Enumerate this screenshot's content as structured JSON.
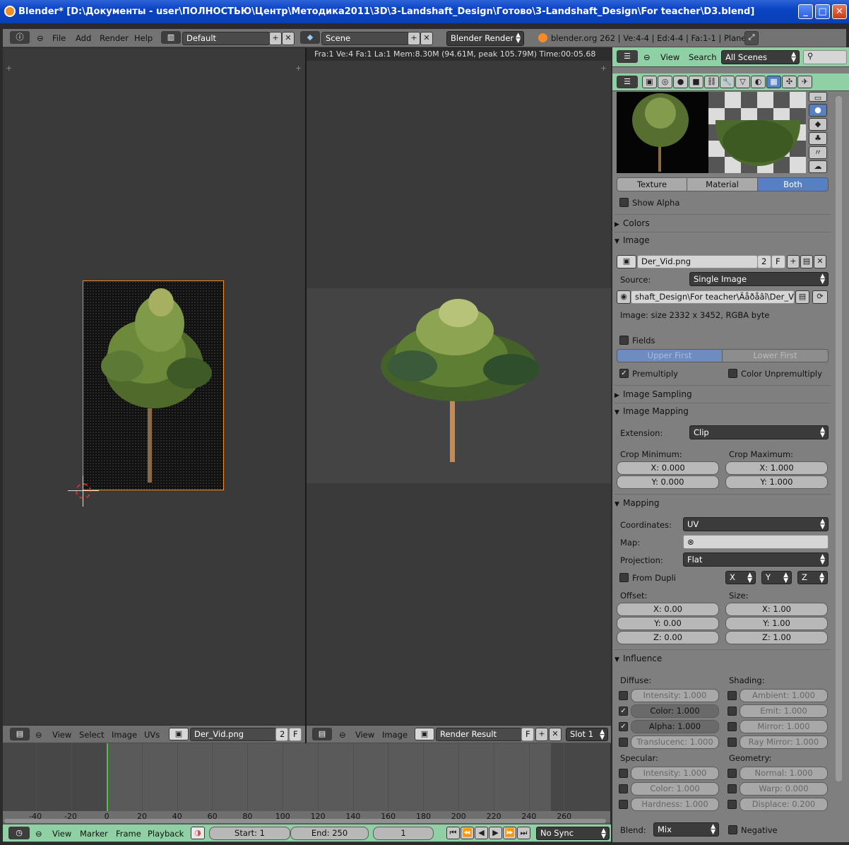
{
  "window": {
    "title": "Blender* [D:\\Документы - user\\ПОЛНОСТЬЮ\\Центр\\Методика2011\\3D\\3-Landshaft_Design\\Готово\\3-Landshaft_Design\\For teacher\\D3.blend]",
    "buttons": {
      "minimize": "_",
      "maximize": "□",
      "close": "✕"
    }
  },
  "info_header": {
    "menus": [
      "File",
      "Add",
      "Render",
      "Help"
    ],
    "screen_layout": "Default",
    "scene": "Scene",
    "render_engine": "Blender Render",
    "stats": "blender.org 262 | Ve:4-4 | Ed:4-4 | Fa:1-1 | Plane"
  },
  "render_stats": "Fra:1  Ve:4 Fa:1 La:1 Mem:8.30M (94.61M, peak 105.79M) Time:00:05.68",
  "uv_editor_header": {
    "menus": [
      "View",
      "Select",
      "Image",
      "UVs"
    ],
    "image_name": "Der_Vid.png",
    "users": "2",
    "fake": "F"
  },
  "image_editor_header": {
    "menus": [
      "View",
      "Image"
    ],
    "image_name": "Render Result",
    "fake": "F",
    "slot": "Slot 1"
  },
  "timeline": {
    "tick_labels": [
      "-40",
      "-20",
      "0",
      "20",
      "40",
      "60",
      "80",
      "100",
      "120",
      "140",
      "160",
      "180",
      "200",
      "220",
      "240",
      "260"
    ],
    "current_frame_marker": 0,
    "menus": [
      "View",
      "Marker",
      "Frame",
      "Playback"
    ],
    "start": "Start: 1",
    "end": "End: 250",
    "frame": "1",
    "sync": "No Sync",
    "transport": [
      "⏮",
      "⏪",
      "◀",
      "▶",
      "⏩",
      "⏭"
    ]
  },
  "properties_header": {
    "menus": [
      "View",
      "Search"
    ],
    "scene_filter": "All Scenes"
  },
  "texture_panel": {
    "preview_tabs": [
      "Texture",
      "Material",
      "Both"
    ],
    "active_preview_tab": "Both",
    "show_alpha": "Show Alpha",
    "sections": {
      "colors": "Colors",
      "image": "Image",
      "image_sampling": "Image Sampling",
      "image_mapping": "Image Mapping",
      "mapping": "Mapping",
      "influence": "Influence"
    },
    "image_name": "Der_Vid.png",
    "image_users": "2",
    "image_fake": "F",
    "source_label": "Source:",
    "source_value": "Single Image",
    "filepath": "shaft_Design\\For teacher\\Äåðåâî\\Der_Vid.png",
    "image_info": "Image: size 2332 x 3452, RGBA byte",
    "fields": "Fields",
    "field_order": [
      "Upper First",
      "Lower First"
    ],
    "premultiply": "Premultiply",
    "color_unpremultiply": "Color Unpremultiply",
    "extension_label": "Extension:",
    "extension_value": "Clip",
    "crop_min_label": "Crop Minimum:",
    "crop_max_label": "Crop Maximum:",
    "crop_min": [
      "X: 0.000",
      "Y: 0.000"
    ],
    "crop_max": [
      "X: 1.000",
      "Y: 1.000"
    ],
    "coordinates_label": "Coordinates:",
    "coordinates_value": "UV",
    "map_label": "Map:",
    "projection_label": "Projection:",
    "projection_value": "Flat",
    "from_dupli": "From Dupli",
    "axes": [
      "X",
      "Y",
      "Z"
    ],
    "offset_label": "Offset:",
    "size_label": "Size:",
    "offset": [
      "X: 0.00",
      "Y: 0.00",
      "Z: 0.00"
    ],
    "size": [
      "X: 1.00",
      "Y: 1.00",
      "Z: 1.00"
    ],
    "diffuse_label": "Diffuse:",
    "shading_label": "Shading:",
    "specular_label": "Specular:",
    "geometry_label": "Geometry:",
    "diffuse": [
      {
        "label": "Intensity: 1.000",
        "checked": false
      },
      {
        "label": "Color: 1.000",
        "checked": true
      },
      {
        "label": "Alpha: 1.000",
        "checked": true
      },
      {
        "label": "Translucenc: 1.000",
        "checked": false
      }
    ],
    "shading": [
      "Ambient: 1.000",
      "Emit: 1.000",
      "Mirror: 1.000",
      "Ray Mirror: 1.000"
    ],
    "specular": [
      "Intensity: 1.000",
      "Color: 1.000",
      "Hardness: 1.000"
    ],
    "geometry": [
      "Normal: 1.000",
      "Warp: 0.000",
      "Displace: 0.200"
    ],
    "blend_label": "Blend:",
    "blend_value": "Mix",
    "negative": "Negative"
  },
  "colors": {
    "accent_blue": "#5680c2",
    "header_green": "#8fd0a4",
    "frame_marker": "#4ec04e",
    "selection_orange": "#ff8c1a"
  }
}
